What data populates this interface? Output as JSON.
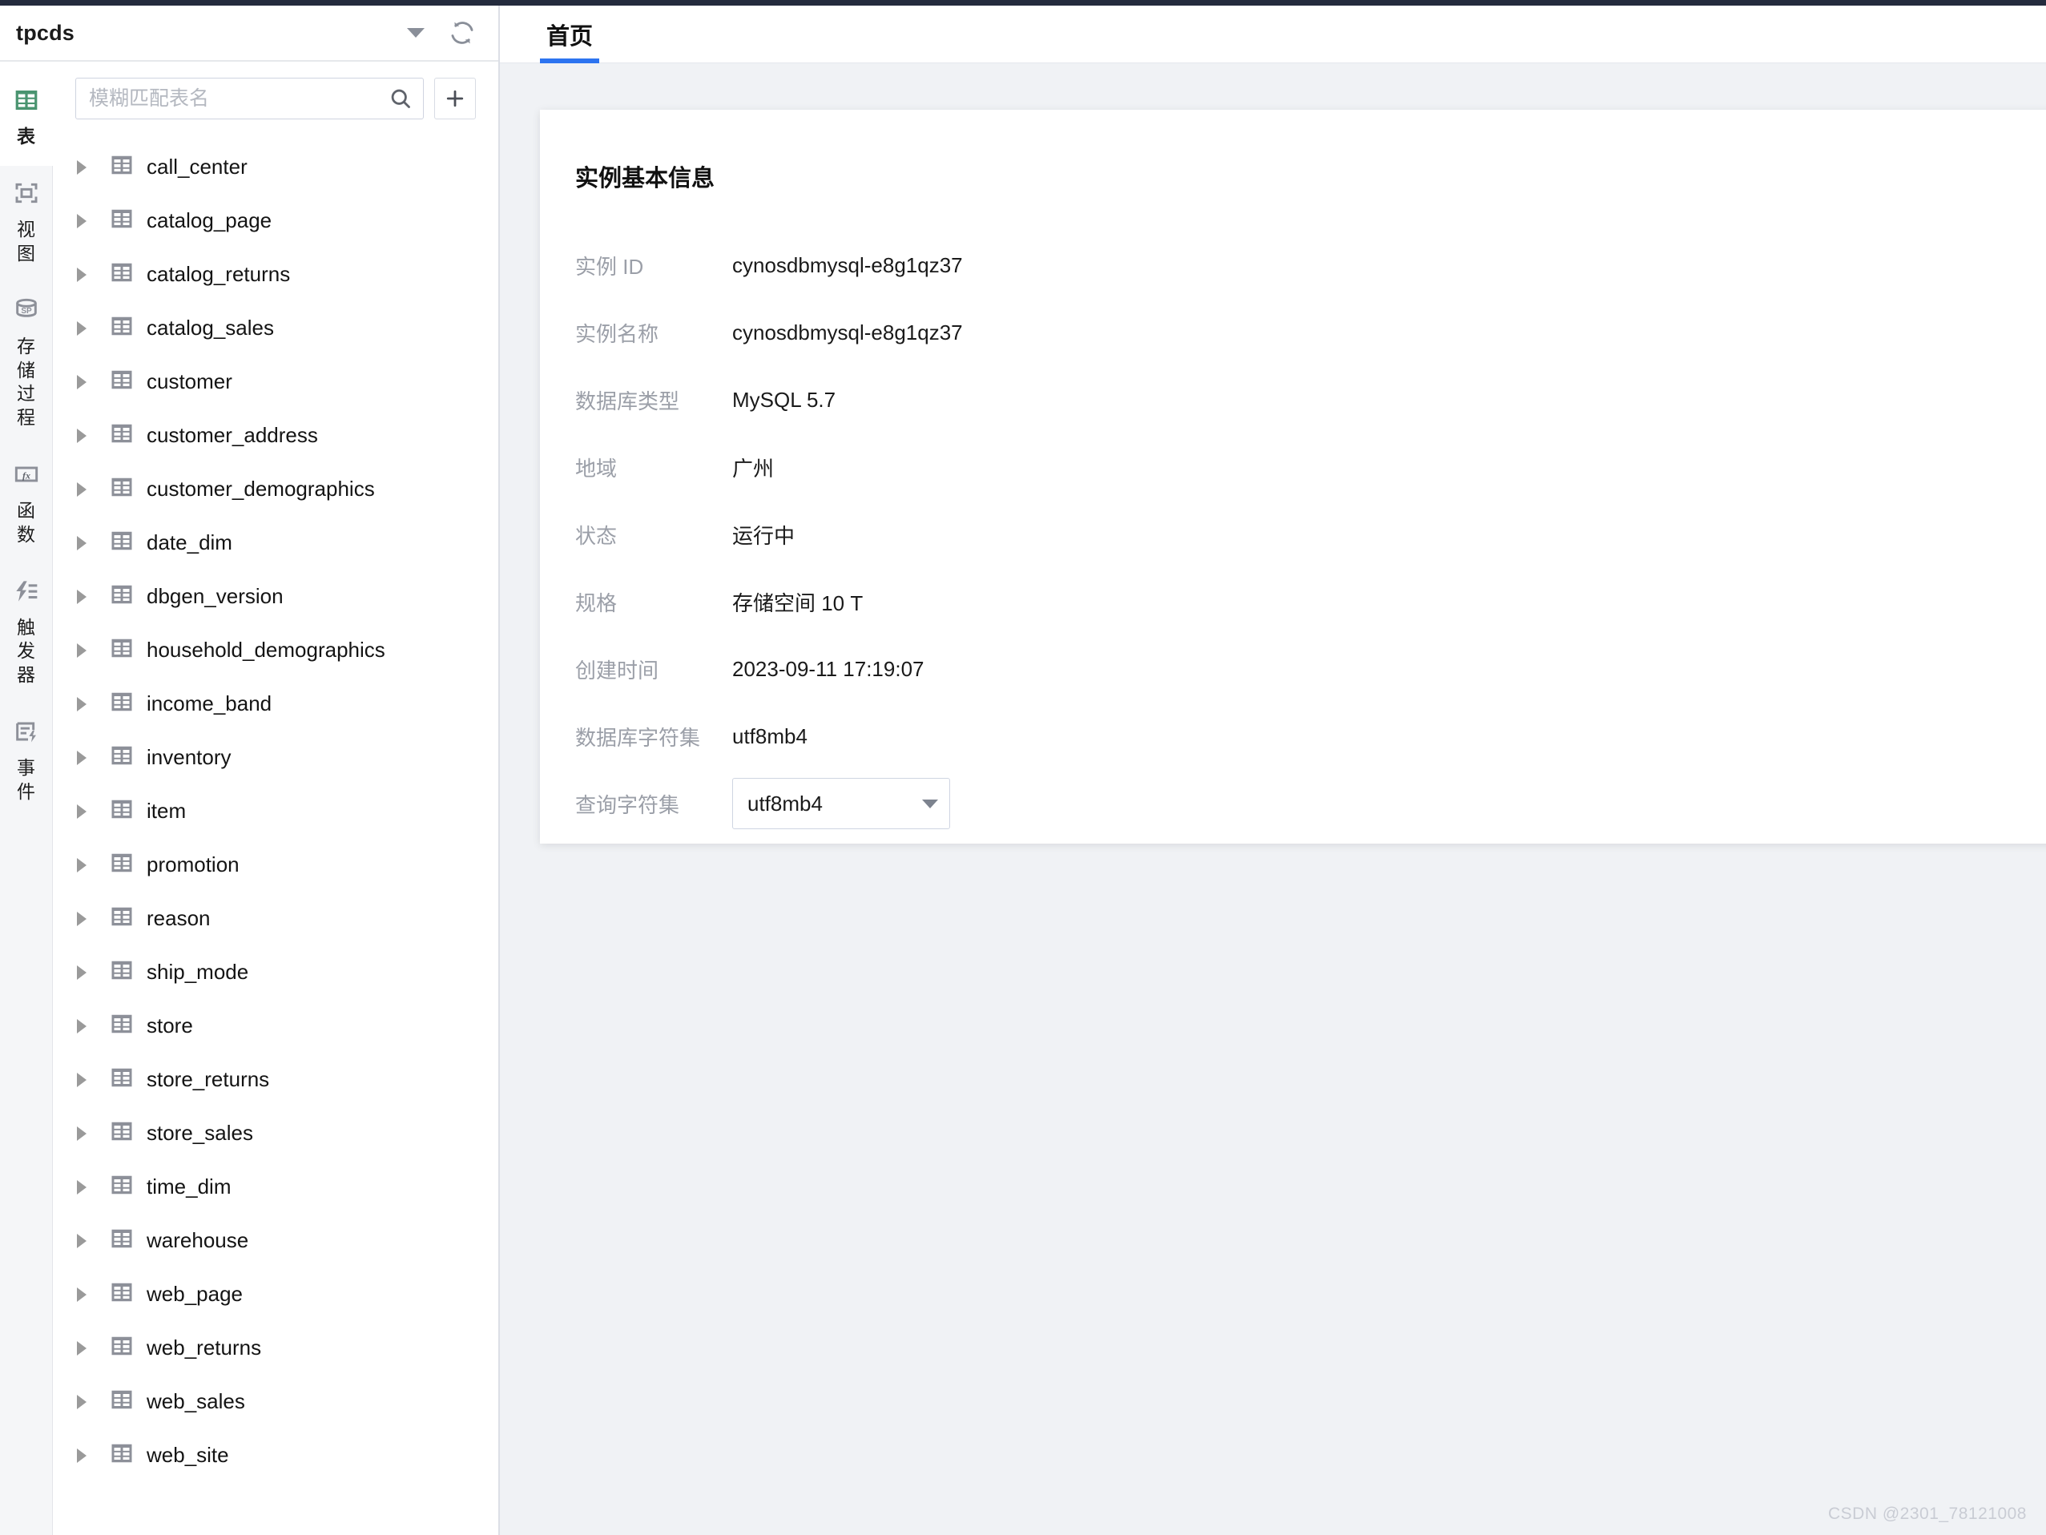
{
  "sidebar": {
    "database_name": "tpcds",
    "dropdown_icon": "chevron-down-icon",
    "refresh_icon": "refresh-icon",
    "search": {
      "placeholder": "模糊匹配表名",
      "value": "",
      "icon": "search-icon"
    },
    "add_button_label": "+",
    "rail": [
      {
        "label": "表",
        "icon": "table-icon",
        "active": true
      },
      {
        "label": "视图",
        "icon": "view-icon",
        "active": false
      },
      {
        "label": "存储过程",
        "icon": "stored-procedure-icon",
        "active": false
      },
      {
        "label": "函数",
        "icon": "function-icon",
        "active": false
      },
      {
        "label": "触发器",
        "icon": "trigger-icon",
        "active": false
      },
      {
        "label": "事件",
        "icon": "event-icon",
        "active": false
      }
    ],
    "tables": [
      "call_center",
      "catalog_page",
      "catalog_returns",
      "catalog_sales",
      "customer",
      "customer_address",
      "customer_demographics",
      "date_dim",
      "dbgen_version",
      "household_demographics",
      "income_band",
      "inventory",
      "item",
      "promotion",
      "reason",
      "ship_mode",
      "store",
      "store_returns",
      "store_sales",
      "time_dim",
      "warehouse",
      "web_page",
      "web_returns",
      "web_sales",
      "web_site"
    ]
  },
  "tabs": [
    {
      "label": "首页",
      "active": true
    }
  ],
  "card": {
    "title": "实例基本信息",
    "rows": [
      {
        "label": "实例 ID",
        "value": "cynosdbmysql-e8g1qz37",
        "type": "text"
      },
      {
        "label": "实例名称",
        "value": "cynosdbmysql-e8g1qz37",
        "type": "text"
      },
      {
        "label": "数据库类型",
        "value": "MySQL 5.7",
        "type": "text"
      },
      {
        "label": "地域",
        "value": "广州",
        "type": "text"
      },
      {
        "label": "状态",
        "value": "运行中",
        "type": "text"
      },
      {
        "label": "规格",
        "value": "存储空间 10 T",
        "type": "text"
      },
      {
        "label": "创建时间",
        "value": "2023-09-11 17:19:07",
        "type": "text"
      },
      {
        "label": "数据库字符集",
        "value": "utf8mb4",
        "type": "text"
      },
      {
        "label": "查询字符集",
        "value": "utf8mb4",
        "type": "select"
      }
    ]
  },
  "watermark": "CSDN @2301_78121008",
  "colors": {
    "accent_blue": "#2d74f0",
    "active_green": "#4a9470",
    "topbar_dark": "#242b3d",
    "page_bg": "#f0f2f5"
  }
}
